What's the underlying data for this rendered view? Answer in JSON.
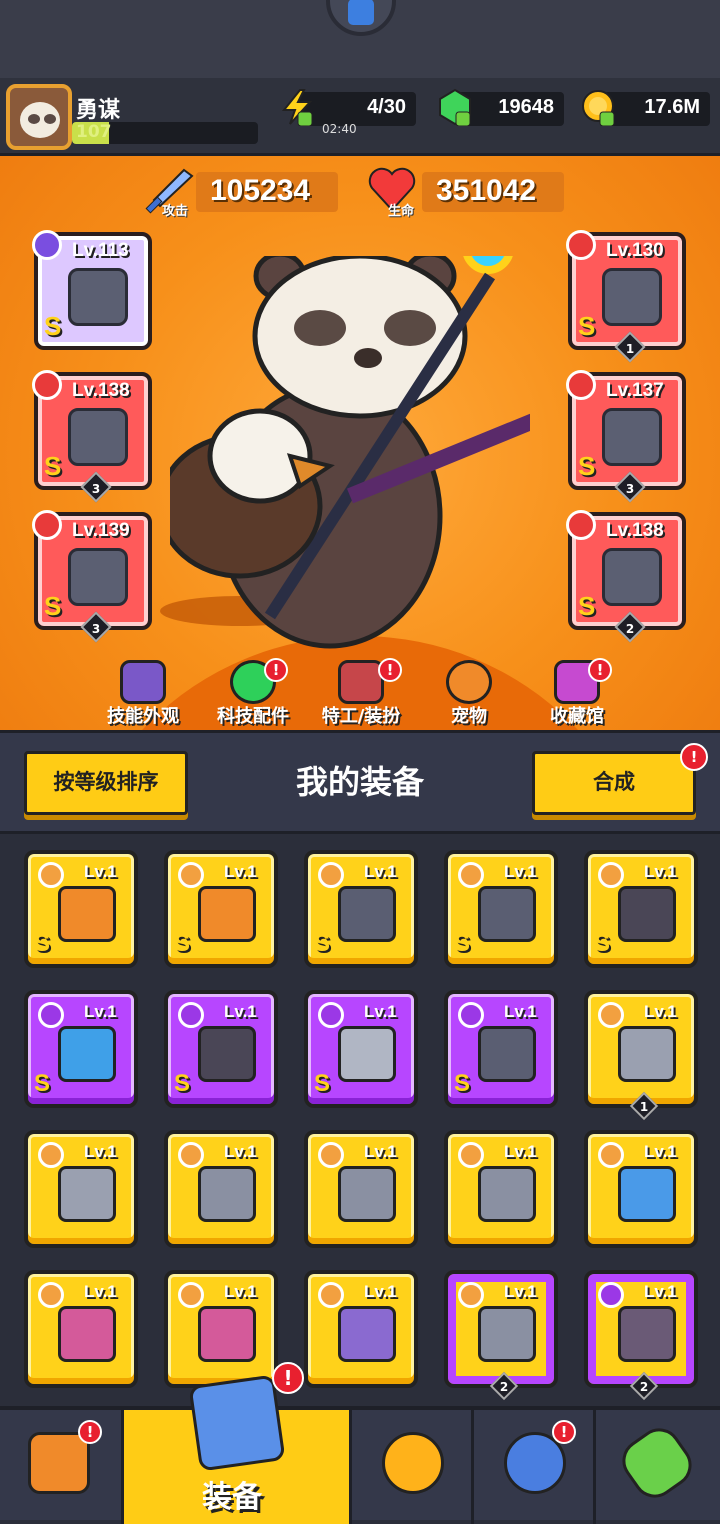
{
  "player": {
    "name": "勇谋",
    "level": "107",
    "level_progress": 0.2
  },
  "resources": {
    "energy": {
      "value": "4/30",
      "timer": "02:40",
      "icon": "lightning-icon"
    },
    "gems": {
      "value": "19648",
      "icon": "green-gem-icon"
    },
    "coins": {
      "value": "17.6M",
      "icon": "gold-coin-icon"
    }
  },
  "stats": {
    "attack": {
      "label": "攻击",
      "value": "105234",
      "icon": "sword-icon"
    },
    "health": {
      "label": "生命",
      "value": "351042",
      "icon": "heart-icon"
    }
  },
  "equipped": [
    {
      "lv": "Lv.113",
      "rank": "S",
      "stars": "",
      "item": "magic-staff",
      "slot": "weapon-slot",
      "color": "purple"
    },
    {
      "lv": "Lv.138",
      "rank": "S",
      "stars": "3",
      "item": "star-necklace",
      "slot": "necklace-slot",
      "color": "red"
    },
    {
      "lv": "Lv.139",
      "rank": "S",
      "stars": "3",
      "item": "mech-glove",
      "slot": "glove-slot",
      "color": "red"
    },
    {
      "lv": "Lv.130",
      "rank": "S",
      "stars": "1",
      "item": "mech-armor",
      "slot": "armor-slot",
      "color": "red"
    },
    {
      "lv": "Lv.137",
      "rank": "S",
      "stars": "3",
      "item": "spiked-belt",
      "slot": "belt-slot",
      "color": "red"
    },
    {
      "lv": "Lv.138",
      "rank": "S",
      "stars": "2",
      "item": "spiked-boots",
      "slot": "boots-slot",
      "color": "red"
    }
  ],
  "tabs": [
    {
      "label": "技能外观",
      "badge": false,
      "icon": "skill-skin-icon"
    },
    {
      "label": "科技配件",
      "badge": true,
      "icon": "tech-part-icon"
    },
    {
      "label": "特工/装扮",
      "badge": true,
      "icon": "agent-icon"
    },
    {
      "label": "宠物",
      "badge": false,
      "icon": "pet-icon"
    },
    {
      "label": "收藏馆",
      "badge": true,
      "icon": "collection-icon"
    }
  ],
  "toolbar": {
    "sort_label": "按等级排序",
    "title": "我的装备",
    "merge_label": "合成"
  },
  "inventory": [
    {
      "lv": "Lv.1",
      "rank": "S",
      "stars": "",
      "tier": "yellow",
      "item": "sword"
    },
    {
      "lv": "Lv.1",
      "rank": "S",
      "stars": "",
      "tier": "yellow",
      "item": "sword"
    },
    {
      "lv": "Lv.1",
      "rank": "S",
      "stars": "",
      "tier": "yellow",
      "item": "spiked-mace"
    },
    {
      "lv": "Lv.1",
      "rank": "S",
      "stars": "",
      "tier": "yellow",
      "item": "spiked-mace"
    },
    {
      "lv": "Lv.1",
      "rank": "S",
      "stars": "",
      "tier": "yellow",
      "item": "spiked-boots"
    },
    {
      "lv": "Lv.1",
      "rank": "S",
      "stars": "",
      "tier": "purple",
      "item": "water-gun"
    },
    {
      "lv": "Lv.1",
      "rank": "S",
      "stars": "",
      "tier": "purple",
      "item": "dark-armor"
    },
    {
      "lv": "Lv.1",
      "rank": "S",
      "stars": "",
      "tier": "purple",
      "item": "silver-armor"
    },
    {
      "lv": "Lv.1",
      "rank": "S",
      "stars": "",
      "tier": "purple",
      "item": "spiked-belt"
    },
    {
      "lv": "Lv.1",
      "rank": "",
      "stars": "1",
      "tier": "yellow",
      "item": "kunai"
    },
    {
      "lv": "Lv.1",
      "rank": "",
      "stars": "",
      "tier": "yellow",
      "item": "kunai"
    },
    {
      "lv": "Lv.1",
      "rank": "",
      "stars": "",
      "tier": "yellow",
      "item": "chest-armor"
    },
    {
      "lv": "Lv.1",
      "rank": "",
      "stars": "",
      "tier": "yellow",
      "item": "chest-armor"
    },
    {
      "lv": "Lv.1",
      "rank": "",
      "stars": "",
      "tier": "yellow",
      "item": "chest-armor"
    },
    {
      "lv": "Lv.1",
      "rank": "",
      "stars": "",
      "tier": "yellow",
      "item": "feather-glove"
    },
    {
      "lv": "Lv.1",
      "rank": "",
      "stars": "",
      "tier": "yellow",
      "item": "claw-boots"
    },
    {
      "lv": "Lv.1",
      "rank": "",
      "stars": "",
      "tier": "yellow",
      "item": "claw-boots"
    },
    {
      "lv": "Lv.1",
      "rank": "",
      "stars": "",
      "tier": "yellow",
      "item": "sneaker"
    },
    {
      "lv": "Lv.1",
      "rank": "",
      "stars": "2",
      "tier": "purple-border",
      "item": "chest-armor"
    },
    {
      "lv": "Lv.1",
      "rank": "",
      "stars": "2",
      "tier": "purple-border",
      "item": "belt"
    }
  ],
  "nav": [
    {
      "label": "",
      "icon": "shop-icon",
      "badge": true,
      "active": false
    },
    {
      "label": "装备",
      "icon": "equipment-icon",
      "badge": true,
      "active": true
    },
    {
      "label": "",
      "icon": "crossed-swords-star-icon",
      "badge": false,
      "active": false
    },
    {
      "label": "",
      "icon": "stars-orb-icon",
      "badge": true,
      "active": false
    },
    {
      "label": "",
      "icon": "dna-capsule-icon",
      "badge": false,
      "active": false
    }
  ],
  "colors": {
    "yellow": "#ffd21a",
    "purple": "#b746ff",
    "red": "#ff5a5a",
    "orange": "#f7901a"
  }
}
